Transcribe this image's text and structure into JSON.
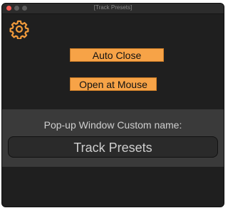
{
  "window": {
    "title": "[Track Presets]"
  },
  "toolbar": {
    "settings_icon": "gear-icon"
  },
  "buttons": {
    "auto_close": "Auto Close",
    "open_at_mouse": "Open at Mouse"
  },
  "custom_name": {
    "label": "Pop-up Window Custom name:",
    "value": "Track Presets"
  },
  "colors": {
    "background": "#1f1f1f",
    "button_accent": "#f7a347",
    "panel": "#3a3a3a",
    "gear": "#f29b3b"
  }
}
